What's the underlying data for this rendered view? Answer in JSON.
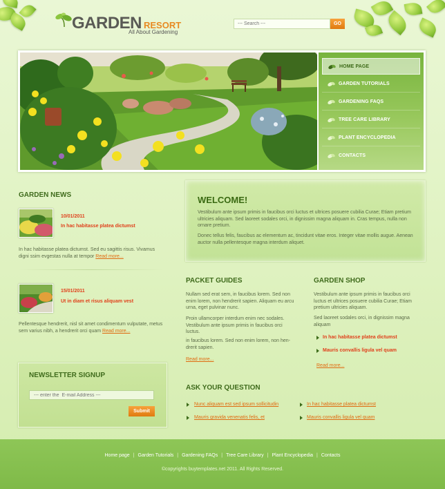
{
  "header": {
    "logo_word1": "GARDEN",
    "logo_word2": "RESORT",
    "tagline": "All About Gardening",
    "search_placeholder": "--- Search ---",
    "search_button": "GO"
  },
  "nav": {
    "items": [
      {
        "label": "HOME PAGE",
        "active": true
      },
      {
        "label": "GARDEN TUTORIALS",
        "active": false
      },
      {
        "label": "GARDENING FAQS",
        "active": false
      },
      {
        "label": "TREE CARE LIBRARY",
        "active": false
      },
      {
        "label": "PLANT ENCYCLOPEDIA",
        "active": false
      },
      {
        "label": "CONTACTS",
        "active": false
      }
    ]
  },
  "news": {
    "title": "GARDEN NEWS",
    "items": [
      {
        "date": "10/01/2011",
        "headline": "In hac habitasse platea dictumst",
        "text": "In hac habitasse platea dictumst. Sed eu sagittis risus. Vivamus digni ssim evgestas nulla at tempor",
        "read_more": "Read more..."
      },
      {
        "date": "15/01/2011",
        "headline": "Ut in diam et risus aliquam vest",
        "text": "Pellentesque hendrerit, nisl sit amet condimentum vulputate, metus sem varius nibh, a hendrerit orci quam",
        "read_more": "Read more..."
      }
    ]
  },
  "welcome": {
    "title": "WELCOME!",
    "para1": "Vestibulum ante ipsum primis in faucibus orci luctus et ultrices posuere cubilia Curae; Etiam pretium ultricies aliquam. Sed laoreet sodales orci, in dignissim magna aliquam in. Cras tempus, nulla non ornare pretium.",
    "para2": "Donec tellus felis, faucibus ac elementum ac, tincidunt vitae eros. Integer vitae mollis augue. Aenean auctor nulla pellentesque magna interdum aliquet."
  },
  "packet_guides": {
    "title": "PACKET GUIDES",
    "para1": "Nullam sed erat sem, in faucibus lorem. Sed non enim lorem, non hendrerit sapien. Aliquam eu arcu urna, eget pulvinar nunc.",
    "para2": "Proin ullamcorper interdum enim nec sodales. Vestibulum ante ipsum primis in faucibus orci luctus.",
    "para3": " in faucibus lorem. Sed non enim lorem, non hen- drerit sapien.",
    "read_more": "Read more..."
  },
  "garden_shop": {
    "title": "GARDEN SHOP",
    "para1": "Vestibulum ante ipsum primis in faucibus orci luctus et ultrices posuere cubilia Curae; Etiam pretium ultricies aliquam.",
    "para2": " Sed laoreet sodales orci, in dignissim magna aliquam",
    "links": [
      "In hac habitasse platea dictumst",
      "Mauris convallis ligula vel quam"
    ],
    "read_more": "Read more..."
  },
  "ask": {
    "title": "ASK YOUR QUESTION",
    "links": [
      "Nunc aliquam est sed ipsum sollicitudin",
      "In hac habitasse platea dictumst",
      "Mauris gravida venenatis felis, et",
      "Mauris convallis ligula vel quam"
    ]
  },
  "newsletter": {
    "title": "NEWSLETTER SIGNUP",
    "placeholder": "--- enter the  E-mail Address ---",
    "button": "Submit"
  },
  "footer": {
    "links": [
      "Home page",
      "Garden Tutorials",
      "Gardening FAQs",
      "Tree Care Library",
      "Plant Encyclopedia",
      "Contacts"
    ],
    "separator": "|",
    "copyright": "©copyrights buytemplates.net 2011.  All Rights Reserved."
  },
  "colors": {
    "accent_orange": "#e88a22",
    "headline_red": "#e0401b",
    "nav_green": "#78b43e",
    "heading_green": "#3f6b1c"
  }
}
